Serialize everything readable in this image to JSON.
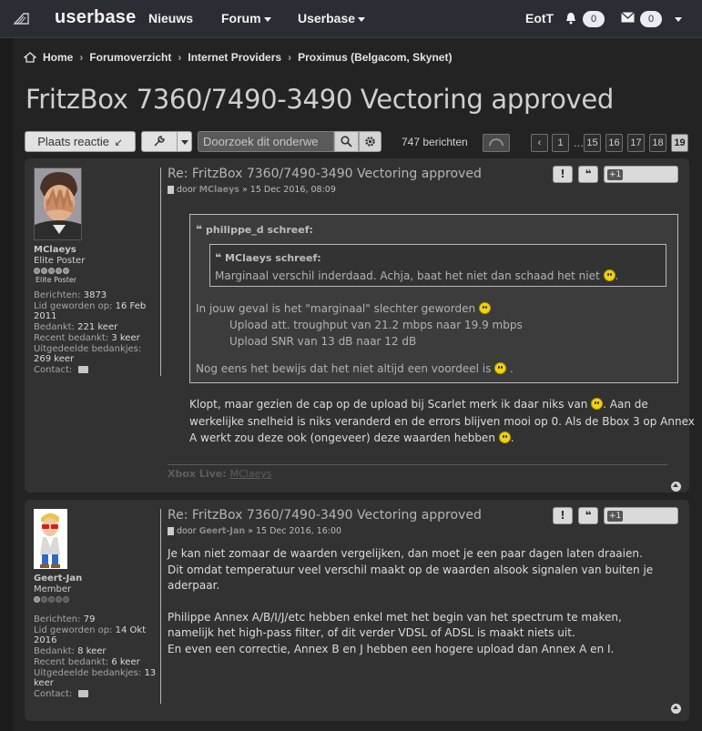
{
  "nav": {
    "brand": "userbase",
    "links": [
      "Nieuws",
      "Forum",
      "Userbase"
    ],
    "user": "EotT",
    "notif_count": "0",
    "msg_count": "0"
  },
  "breadcrumb": [
    "Home",
    "Forumoverzicht",
    "Internet Providers",
    "Proximus (Belgacom, Skynet)"
  ],
  "topic": {
    "title": "FritzBox 7360/7490-3490 Vectoring approved",
    "reply_label": "Plaats reactie",
    "search_placeholder": "Doorzoek dit onderwe",
    "post_count": "747 berichten",
    "pages": [
      "1",
      "…",
      "15",
      "16",
      "17",
      "18",
      "19"
    ]
  },
  "posts": [
    {
      "title": "Re: FritzBox 7360/7490-3490 Vectoring approved",
      "meta_prefix": "door",
      "author": "MClaeys",
      "date": "» 15 Dec 2016, 08:09",
      "thanks_label": "Bedankt!",
      "plus_label": "+1",
      "username": "MClaeys",
      "rank": "Elite Poster",
      "rank_img_label": "Elite Poster",
      "stats": [
        {
          "k": "Berichten:",
          "v": "3873"
        },
        {
          "k": "Lid geworden op:",
          "v": "16 Feb 2011"
        },
        {
          "k": "Bedankt:",
          "v": "221 keer"
        },
        {
          "k": "Recent bedankt:",
          "v": "3 keer"
        },
        {
          "k": "Uitgedeelde bedankjes:",
          "v": "269 keer"
        },
        {
          "k": "Contact:",
          "v": ""
        }
      ],
      "quote_outer_cite": "philippe_d schreef:",
      "quote_inner_cite": "MClaeys schreef:",
      "quote_inner_text": "Marginaal verschil inderdaad. Achja, baat het niet dan schaad het niet",
      "quote_line1": "In jouw geval is het \"marginaal\" slechter geworden",
      "quote_line2": "Upload att. troughput van 21.2 mbps naar 19.9 mbps",
      "quote_line3": "Upload SNR van 13 dB naar 12 dB",
      "quote_line4": "Nog eens het bewijs dat het niet altijd een voordeel is",
      "quote_line4_end": ".",
      "body_part1": "Klopt, maar gezien de cap op de upload bij Scarlet merk ik daar niks van",
      "body_part2": ". Aan de werkelijke snelheid is niks veranderd en de errors blijven mooi op 0. Als de Bbox 3 op Annex A werkt zou deze ook (ongeveer) deze waarden hebben",
      "body_part3": ".",
      "sig_label": "Xbox Live:",
      "sig_value": "MClaeys"
    },
    {
      "title": "Re: FritzBox 7360/7490-3490 Vectoring approved",
      "meta_prefix": "door",
      "author": "Geert-Jan",
      "date": "» 15 Dec 2016, 16:00",
      "thanks_label": "Bedankt!",
      "plus_label": "+1",
      "username": "Geert-Jan",
      "rank": "Member",
      "stats": [
        {
          "k": "Berichten:",
          "v": "79"
        },
        {
          "k": "Lid geworden op:",
          "v": "14 Okt 2016"
        },
        {
          "k": "Bedankt:",
          "v": "8 keer"
        },
        {
          "k": "Recent bedankt:",
          "v": "6 keer"
        },
        {
          "k": "Uitgedeelde bedankjes:",
          "v": "13 keer"
        },
        {
          "k": "Contact:",
          "v": ""
        }
      ],
      "para1": "Je kan niet zomaar de waarden vergelijken, dan moet je een paar dagen laten draaien.",
      "para2": "Dit omdat temperatuur veel verschil maakt op de waarden alsook signalen van buiten je aderpaar.",
      "para3": "Philippe Annex A/B/I/J/etc hebben enkel met het begin van het spectrum te maken, namelijk het high-pass filter, of dit verder VDSL of ADSL is maakt niets uit.",
      "para4": "En even een correctie, Annex B en J hebben een hogere upload dan Annex A en I."
    }
  ]
}
